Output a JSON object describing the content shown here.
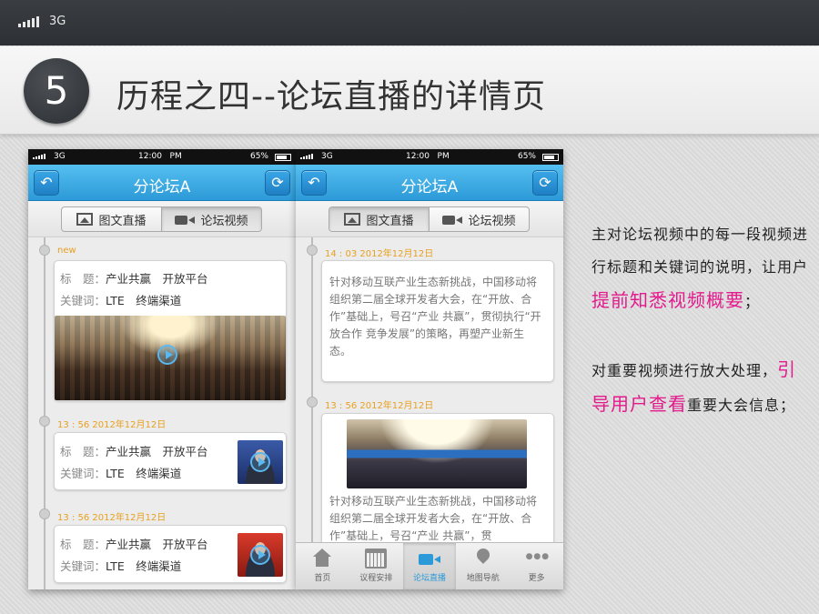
{
  "top_status": {
    "network": "3G"
  },
  "banner": {
    "number": "5",
    "title": "历程之四--论坛直播的详情页"
  },
  "phones": [
    {
      "status": {
        "network": "3G",
        "time": "12:00",
        "ampm": "PM",
        "battery": "65%"
      },
      "nav": {
        "title": "分论坛A"
      },
      "tabs": [
        {
          "label": "图文直播"
        },
        {
          "label": "论坛视频"
        }
      ],
      "new_tag": "new",
      "cards": [
        {
          "title_label": "标　题：",
          "title": "产业共赢　开放平台",
          "kw_label": "关键词：",
          "keywords": "LTE　终端渠道"
        },
        {
          "timestamp": "13 : 56 2012年12月12日",
          "title_label": "标　题：",
          "title": "产业共赢　开放平台",
          "kw_label": "关键词：",
          "keywords": "LTE　终端渠道"
        },
        {
          "timestamp": "13 : 56 2012年12月12日",
          "title_label": "标　题：",
          "title": "产业共赢　开放平台",
          "kw_label": "关键词：",
          "keywords": "LTE　终端渠道"
        }
      ]
    },
    {
      "status": {
        "network": "3G",
        "time": "12:00",
        "ampm": "PM",
        "battery": "65%"
      },
      "nav": {
        "title": "分论坛A"
      },
      "tabs": [
        {
          "label": "图文直播"
        },
        {
          "label": "论坛视频"
        }
      ],
      "posts": [
        {
          "timestamp": "14 : 03 2012年12月12日",
          "text": "针对移动互联产业生态新挑战，中国移动将组织第二届全球开发者大会，在“开放、合作”基础上，号召“产业 共赢”，贯彻执行“开放合作 竞争发展”的策略，再塑产业新生态。"
        },
        {
          "timestamp": "13 : 56 2012年12月12日",
          "text": "针对移动互联产业生态新挑战，中国移动将组织第二届全球开发者大会，在“开放、合作”基础上，号召“产业 共赢”，贯"
        }
      ],
      "tabbar": [
        {
          "label": "首页"
        },
        {
          "label": "议程安排"
        },
        {
          "label": "论坛直播"
        },
        {
          "label": "地图导航"
        },
        {
          "label": "更多"
        }
      ]
    }
  ],
  "description": {
    "p1_a": "主对论坛视频中的每一段视频进行标题和关键词的说明，让用户",
    "p1_hl": "提前知悉视频概要",
    "p1_b": "；",
    "p2_a": "对重要视频进行放大处理，",
    "p2_hl": "引导用户查看",
    "p2_b": "重要大会信息；"
  },
  "colors": {
    "accent_blue": "#2c9ad8",
    "highlight_pink": "#e31a8c",
    "timestamp_orange": "#e8a020"
  }
}
